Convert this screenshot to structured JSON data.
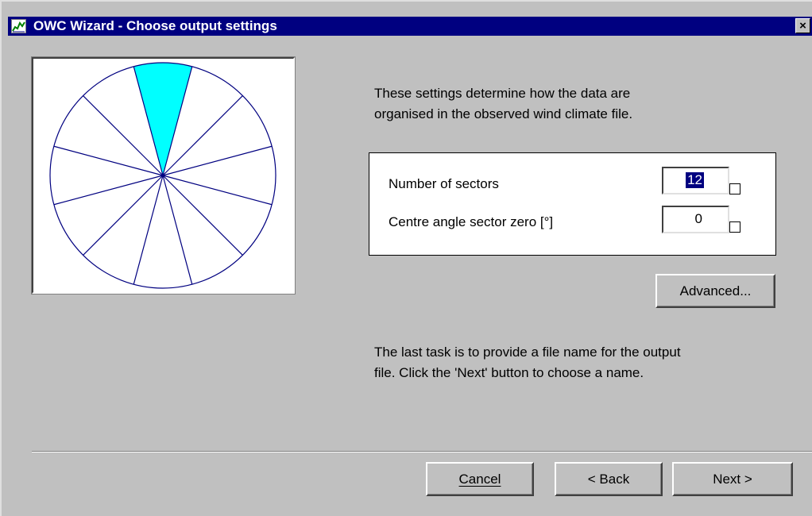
{
  "window": {
    "title": "OWC Wizard - Choose output settings",
    "close_glyph": "×"
  },
  "intro": {
    "line1": "These settings determine how the data are",
    "line2": "organised in the observed wind climate file."
  },
  "settings": {
    "sectors_label": "Number of sectors",
    "sectors_value": "12",
    "centre_label": "Centre angle sector zero [°]",
    "centre_value": "0"
  },
  "advanced_label": "Advanced...",
  "note": {
    "line1": "The last task is to provide a file name for the output",
    "line2": "file. Click the 'Next' button to choose a name."
  },
  "buttons": {
    "cancel": "Cancel",
    "back": "< Back",
    "next": "Next >"
  },
  "sector_diagram": {
    "sector_count": 12,
    "highlight_sector": 0,
    "highlight_color": "#00ffff",
    "line_color": "#000080"
  }
}
